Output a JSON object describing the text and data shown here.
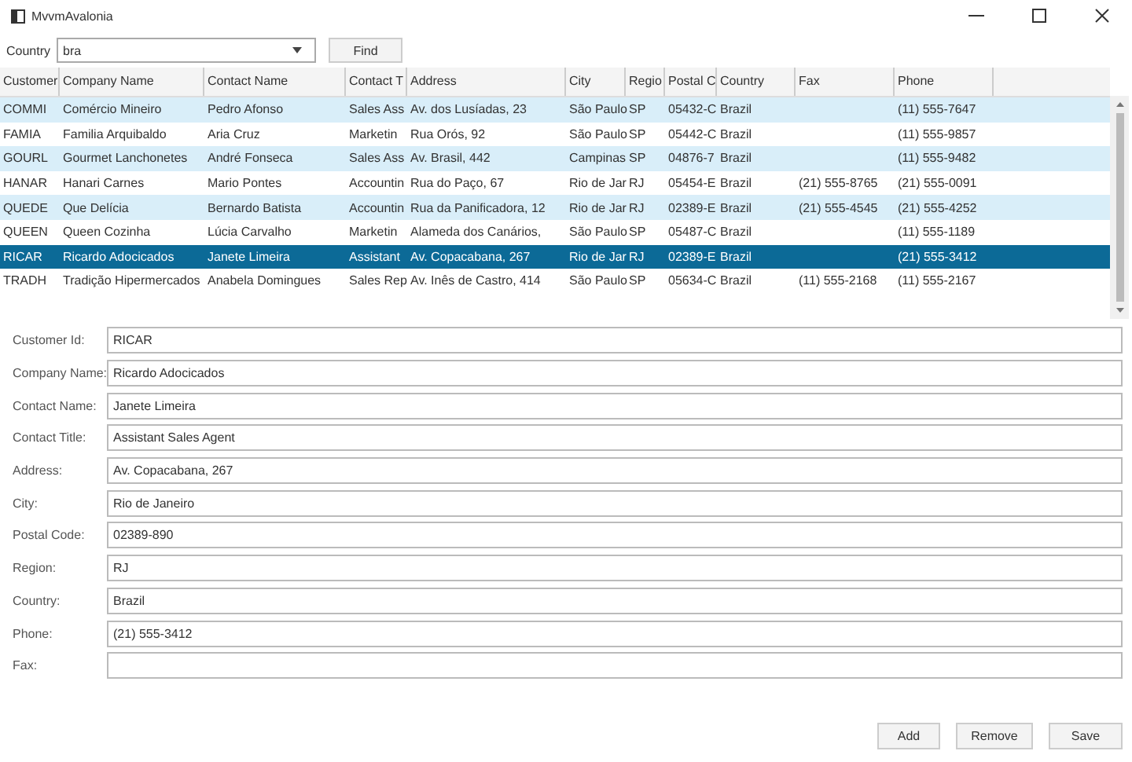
{
  "window": {
    "title": "MvvmAvalonia"
  },
  "filter": {
    "label": "Country",
    "value": "bra",
    "button": "Find"
  },
  "table": {
    "columns": [
      "Customer",
      "Company Name",
      "Contact Name",
      "Contact T",
      "Address",
      "City",
      "Regio",
      "Postal C",
      "Country",
      "Fax",
      "Phone"
    ],
    "rows": [
      {
        "selected": false,
        "cells": [
          "COMMI",
          "Comércio Mineiro",
          "Pedro Afonso",
          "Sales Ass",
          "Av. dos Lusíadas, 23",
          "São Paulo",
          "SP",
          "05432-C",
          "Brazil",
          "",
          "(11) 555-7647"
        ]
      },
      {
        "selected": false,
        "cells": [
          "FAMIA",
          "Familia Arquibaldo",
          "Aria Cruz",
          "Marketin",
          "Rua Orós, 92",
          "São Paulo",
          "SP",
          "05442-C",
          "Brazil",
          "",
          "(11) 555-9857"
        ]
      },
      {
        "selected": false,
        "cells": [
          "GOURL",
          "Gourmet Lanchonetes",
          "André Fonseca",
          "Sales Ass",
          "Av. Brasil, 442",
          "Campinas",
          "SP",
          "04876-7",
          "Brazil",
          "",
          "(11) 555-9482"
        ]
      },
      {
        "selected": false,
        "cells": [
          "HANAR",
          "Hanari Carnes",
          "Mario Pontes",
          "Accountin",
          "Rua do Paço, 67",
          "Rio de Jar",
          "RJ",
          "05454-E",
          "Brazil",
          "(21) 555-8765",
          "(21) 555-0091"
        ]
      },
      {
        "selected": false,
        "cells": [
          "QUEDE",
          "Que Delícia",
          "Bernardo Batista",
          "Accountin",
          "Rua da Panificadora, 12",
          "Rio de Jar",
          "RJ",
          "02389-E",
          "Brazil",
          "(21) 555-4545",
          "(21) 555-4252"
        ]
      },
      {
        "selected": false,
        "cells": [
          "QUEEN",
          "Queen Cozinha",
          "Lúcia Carvalho",
          "Marketin",
          "Alameda dos Canários,",
          "São Paulo",
          "SP",
          "05487-C",
          "Brazil",
          "",
          "(11) 555-1189"
        ]
      },
      {
        "selected": true,
        "cells": [
          "RICAR",
          "Ricardo Adocicados",
          "Janete Limeira",
          "Assistant",
          "Av. Copacabana, 267",
          "Rio de Jar",
          "RJ",
          "02389-E",
          "Brazil",
          "",
          "(21) 555-3412"
        ]
      },
      {
        "selected": false,
        "cells": [
          "TRADH",
          "Tradição Hipermercados",
          "Anabela Domingues",
          "Sales Rep",
          "Av. Inês de Castro, 414",
          "São Paulo",
          "SP",
          "05634-C",
          "Brazil",
          "(11) 555-2168",
          "(11) 555-2167"
        ]
      }
    ]
  },
  "form": {
    "fields": [
      {
        "label": "Customer Id:",
        "value": "RICAR"
      },
      {
        "label": "Company Name:",
        "value": "Ricardo Adocicados"
      },
      {
        "label": "Contact Name:",
        "value": "Janete Limeira"
      },
      {
        "label": "Contact Title:",
        "value": "Assistant Sales Agent"
      },
      {
        "label": "Address:",
        "value": "Av. Copacabana, 267"
      },
      {
        "label": "City:",
        "value": "Rio de Janeiro"
      },
      {
        "label": "Postal Code:",
        "value": "02389-890"
      },
      {
        "label": "Region:",
        "value": "RJ"
      },
      {
        "label": "Country:",
        "value": "Brazil"
      },
      {
        "label": "Phone:",
        "value": "(21) 555-3412"
      },
      {
        "label": "Fax:"
      }
    ]
  },
  "buttons": [
    "Add",
    "Remove",
    "Save"
  ]
}
